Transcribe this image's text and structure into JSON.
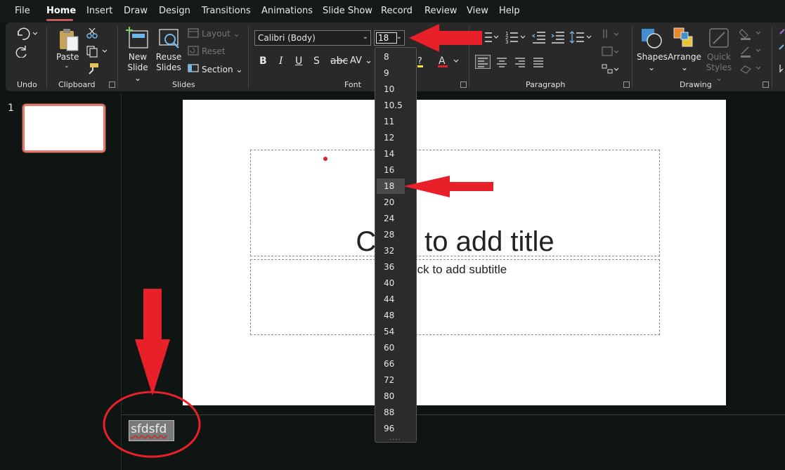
{
  "menu": {
    "tabs": [
      "File",
      "Home",
      "Insert",
      "Draw",
      "Design",
      "Transitions",
      "Animations",
      "Slide Show",
      "Record",
      "Review",
      "View",
      "Help"
    ],
    "active": "Home"
  },
  "ribbon": {
    "groups": {
      "undo": "Undo",
      "clipboard": "Clipboard",
      "slides": "Slides",
      "font": "Font",
      "paragraph": "Paragraph",
      "drawing": "Drawing"
    },
    "paste": "Paste",
    "new_slide": [
      "New",
      "Slide"
    ],
    "reuse_slides": [
      "Reuse",
      "Slides"
    ],
    "layout": "Layout",
    "reset": "Reset",
    "section": "Section",
    "font_name": "Calibri (Body)",
    "font_size": "18",
    "bold": "B",
    "italic": "I",
    "underline": "U",
    "strike": "S",
    "char_spacing": "AV",
    "shapes": "Shapes",
    "arrange": "Arrange",
    "quick_styles": [
      "Quick",
      "Styles"
    ]
  },
  "font_size_dropdown": {
    "options": [
      "8",
      "9",
      "10",
      "10.5",
      "11",
      "12",
      "14",
      "16",
      "18",
      "20",
      "24",
      "28",
      "32",
      "36",
      "40",
      "44",
      "48",
      "54",
      "60",
      "66",
      "72",
      "80",
      "88",
      "96"
    ],
    "selected": "18",
    "grip": "····"
  },
  "slide_pane": {
    "slide_number": "1"
  },
  "slide": {
    "title_placeholder": "Click to add title",
    "subtitle_placeholder": "Click to add subtitle"
  },
  "notes": {
    "text": "sfdsfd"
  },
  "colors": {
    "annotation_red": "#e8202a",
    "thumbnail_border": "#e07a6a",
    "accent_underline": "#c55a5a"
  }
}
